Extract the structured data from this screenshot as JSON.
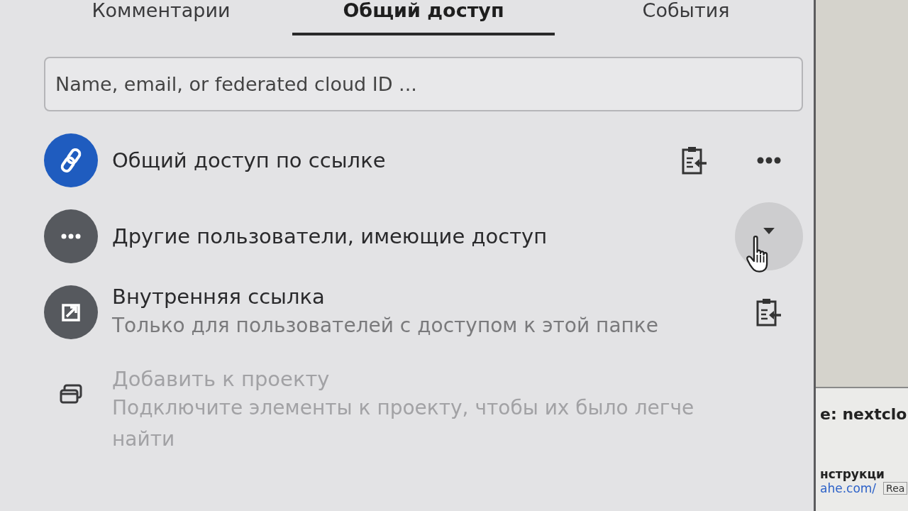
{
  "tabs": [
    {
      "label": "Комментарии",
      "selected": false
    },
    {
      "label": "Общий доступ",
      "selected": true
    },
    {
      "label": "События",
      "selected": false
    }
  ],
  "search": {
    "placeholder": "Name, email, or federated cloud ID ..."
  },
  "entries": [
    {
      "kind": "link",
      "title": "Общий доступ по ссылке",
      "disabled": false,
      "actions": [
        {
          "kind": "copy",
          "hovered": false
        },
        {
          "kind": "menu",
          "hovered": false
        }
      ]
    },
    {
      "kind": "others",
      "title": "Другие пользователи, имеющие доступ",
      "disabled": false,
      "actions": [
        {
          "kind": "caret",
          "hovered": true
        }
      ]
    },
    {
      "kind": "internal",
      "title": "Внутренняя ссылка",
      "subtitle": "Только для пользователей с доступом к этой папке",
      "disabled": false,
      "actions": [
        {
          "kind": "copy",
          "hovered": false
        }
      ]
    },
    {
      "kind": "project",
      "title": "Добавить к проекту",
      "subtitle": "Подключите элементы к проекту, чтобы их было легче найти",
      "disabled": true
    }
  ],
  "background_window": {
    "heading": "e: nextclo",
    "text": "нструкци",
    "link": "ahe.com/",
    "button": "Rea"
  }
}
